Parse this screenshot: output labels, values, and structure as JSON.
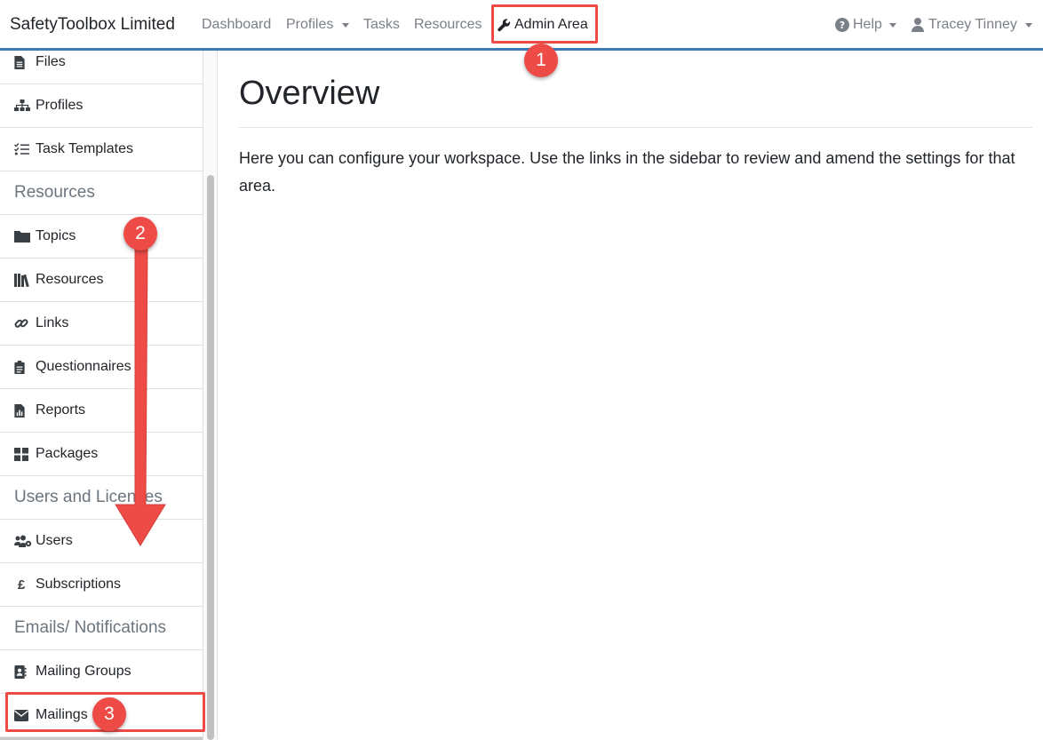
{
  "navbar": {
    "brand": "SafetyToolbox Limited",
    "dashboard": "Dashboard",
    "profiles": "Profiles",
    "tasks": "Tasks",
    "resources": "Resources",
    "admin_area": "Admin Area",
    "help": "Help",
    "user": "Tracey Tinney"
  },
  "sidebar": {
    "items": [
      {
        "label": "Files",
        "icon": "file-icon"
      },
      {
        "label": "Profiles",
        "icon": "sitemap-icon"
      },
      {
        "label": "Task Templates",
        "icon": "tasks-icon"
      }
    ],
    "resources_heading": "Resources",
    "resources_items": [
      {
        "label": "Topics",
        "icon": "folder-icon"
      },
      {
        "label": "Resources",
        "icon": "books-icon"
      },
      {
        "label": "Links",
        "icon": "link-icon"
      },
      {
        "label": "Questionnaires",
        "icon": "clipboard-icon"
      },
      {
        "label": "Reports",
        "icon": "report-icon"
      },
      {
        "label": "Packages",
        "icon": "grid-icon"
      }
    ],
    "users_heading": "Users and Licences",
    "users_items": [
      {
        "label": "Users",
        "icon": "users-cog-icon"
      },
      {
        "label": "Subscriptions",
        "icon": "pound-icon"
      }
    ],
    "emails_heading": "Emails/ Notifications",
    "emails_items": [
      {
        "label": "Mailing Groups",
        "icon": "address-book-icon"
      },
      {
        "label": "Mailings",
        "icon": "envelope-icon"
      }
    ]
  },
  "main": {
    "title": "Overview",
    "text": "Here you can configure your workspace. Use the links in the sidebar to review and amend the settings for that area."
  },
  "annotations": {
    "step1": "1",
    "step2": "2",
    "step3": "3",
    "color": "#ee4b47"
  },
  "colors": {
    "navbar_border": "#3d7ab8",
    "muted": "#7b8088",
    "heading_muted": "#6c757d"
  }
}
